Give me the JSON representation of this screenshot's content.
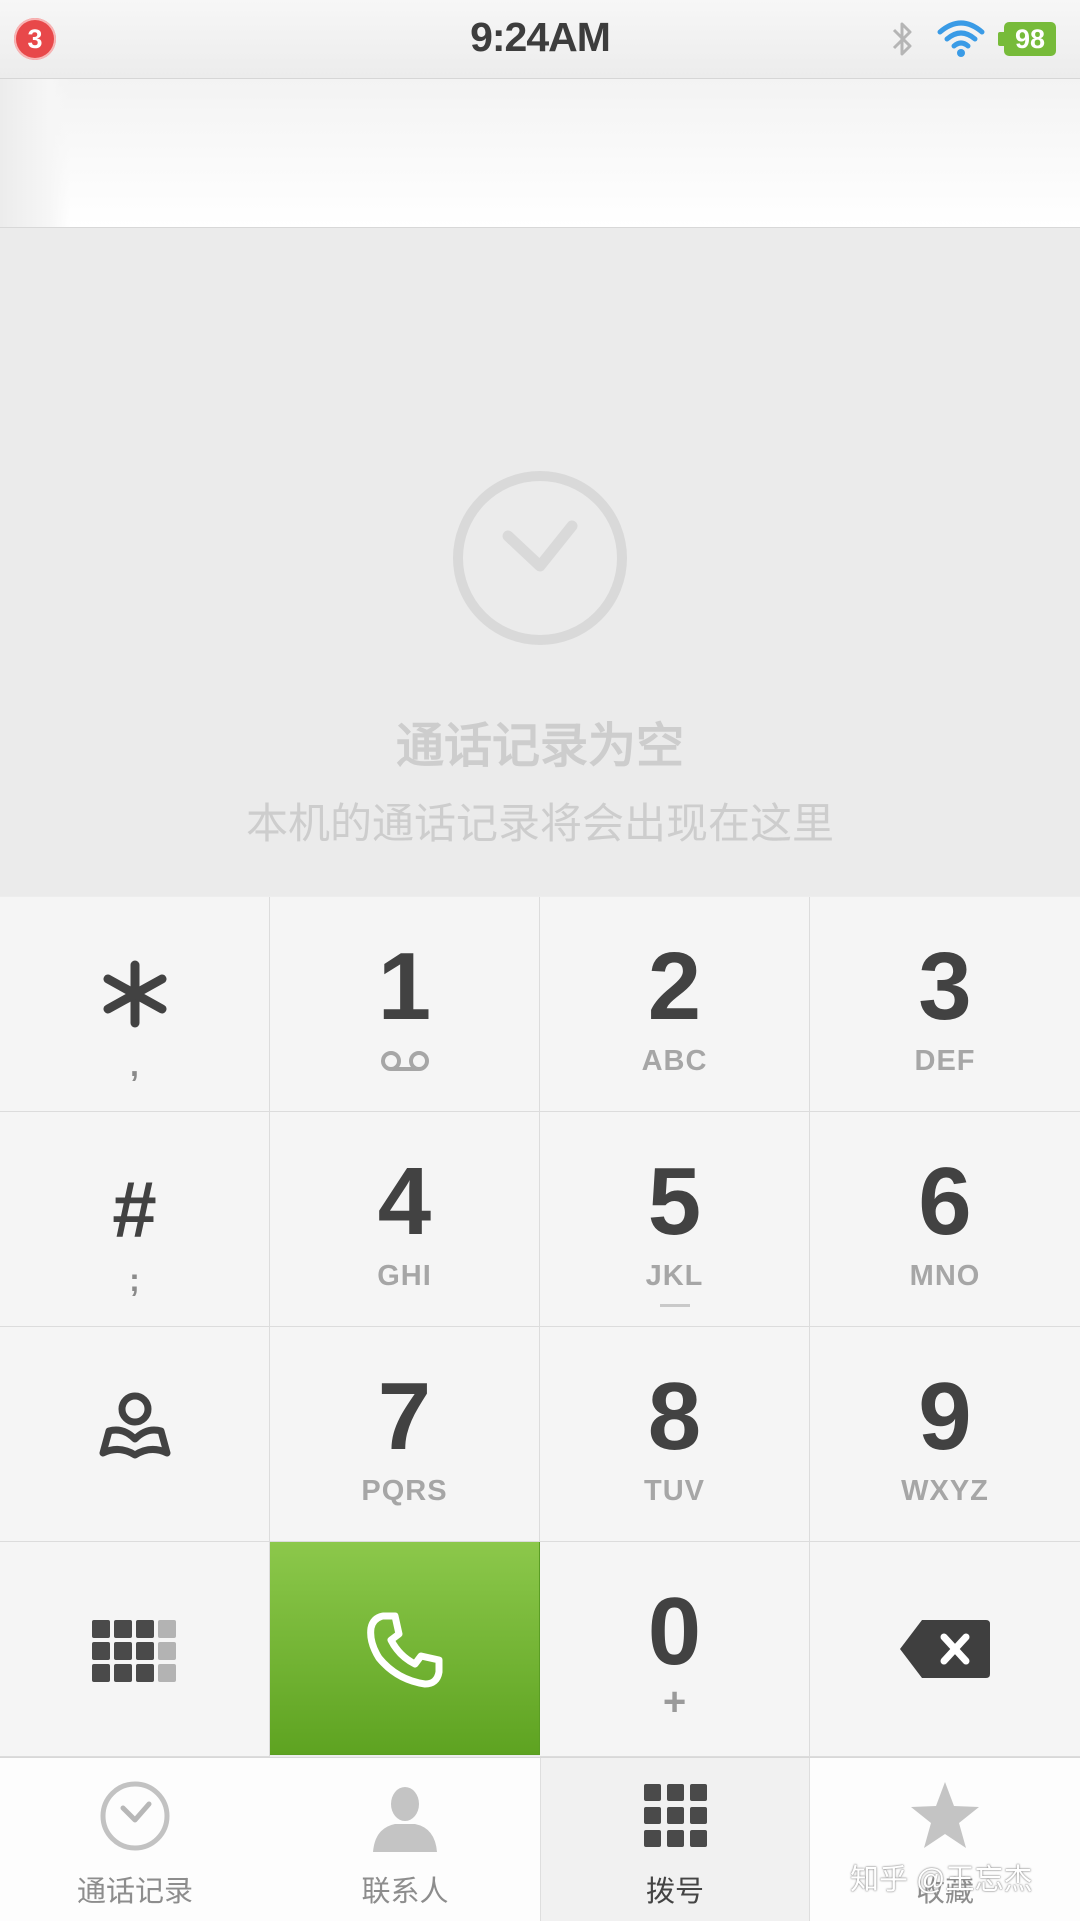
{
  "status_bar": {
    "notification_count": "3",
    "time": "9:24AM",
    "battery": "98",
    "icons": [
      "bluetooth-icon",
      "wifi-icon",
      "battery-icon"
    ],
    "battery_color": "#77bb3a"
  },
  "empty_state": {
    "icon": "clock-icon",
    "title": "通话记录为空",
    "subtitle": "本机的通话记录将会出现在这里"
  },
  "keypad": {
    "star": {
      "symbol": "*",
      "secondary": ","
    },
    "k1": {
      "digit": "1",
      "icon": "voicemail-icon"
    },
    "k2": {
      "digit": "2",
      "letters": "ABC"
    },
    "k3": {
      "digit": "3",
      "letters": "DEF"
    },
    "hash": {
      "symbol": "#",
      "secondary": ";"
    },
    "k4": {
      "digit": "4",
      "letters": "GHI"
    },
    "k5": {
      "digit": "5",
      "letters": "JKL"
    },
    "k6": {
      "digit": "6",
      "letters": "MNO"
    },
    "contacts": {
      "icon": "contacts-book-icon"
    },
    "k7": {
      "digit": "7",
      "letters": "PQRS"
    },
    "k8": {
      "digit": "8",
      "letters": "TUV"
    },
    "k9": {
      "digit": "9",
      "letters": "WXYZ"
    },
    "toggle": {
      "icon": "keypad-grid-icon"
    },
    "call": {
      "icon": "phone-icon",
      "color": "#76b832"
    },
    "k0": {
      "digit": "0",
      "secondary": "+"
    },
    "backspace": {
      "icon": "backspace-icon"
    }
  },
  "tabs": [
    {
      "label": "通话记录",
      "icon": "clock-icon"
    },
    {
      "label": "联系人",
      "icon": "person-icon"
    },
    {
      "label": "拨号",
      "icon": "dialpad-icon",
      "active": true
    },
    {
      "label": "收藏",
      "icon": "star-icon"
    }
  ],
  "watermark": "知乎 @王忘杰"
}
